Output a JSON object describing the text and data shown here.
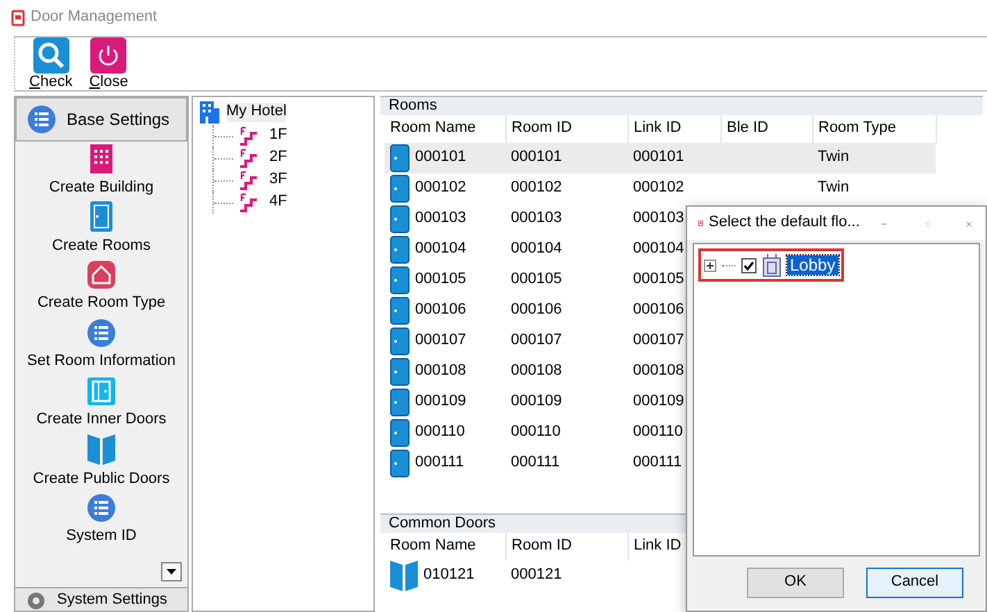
{
  "window": {
    "title": "Door Management"
  },
  "toolbar": [
    {
      "label": "Check",
      "kind": "search"
    },
    {
      "label": "Close",
      "kind": "power"
    }
  ],
  "nav": {
    "header": "Base Settings",
    "items": [
      {
        "label": "Create Building",
        "kind": "building"
      },
      {
        "label": "Create Rooms",
        "kind": "door"
      },
      {
        "label": "Create Room Type",
        "kind": "house"
      },
      {
        "label": "Set Room Information",
        "kind": "list"
      },
      {
        "label": "Create Inner Doors",
        "kind": "inner"
      },
      {
        "label": "Create Public Doors",
        "kind": "double"
      },
      {
        "label": "System ID",
        "kind": "list"
      }
    ],
    "footer": "System Settings"
  },
  "tree": {
    "root": "My Hotel",
    "children": [
      {
        "label": "1F"
      },
      {
        "label": "2F"
      },
      {
        "label": "3F"
      },
      {
        "label": "4F"
      }
    ]
  },
  "rooms": {
    "title": "Rooms",
    "columns": [
      "Room Name",
      "Room ID",
      "Link ID",
      "Ble ID",
      "Room Type"
    ],
    "rows": [
      {
        "name": "000101",
        "room_id": "000101",
        "link_id": "000101",
        "room_type": "Twin",
        "selected": true
      },
      {
        "name": "000102",
        "room_id": "000102",
        "link_id": "000102",
        "room_type": "Twin",
        "selected": false
      },
      {
        "name": "000103",
        "room_id": "000103",
        "link_id": "000103",
        "selected": false
      },
      {
        "name": "000104",
        "room_id": "000104",
        "link_id": "000104",
        "selected": false
      },
      {
        "name": "000105",
        "room_id": "000105",
        "link_id": "000105",
        "selected": false
      },
      {
        "name": "000106",
        "room_id": "000106",
        "link_id": "000106",
        "selected": false
      },
      {
        "name": "000107",
        "room_id": "000107",
        "link_id": "000107",
        "selected": false
      },
      {
        "name": "000108",
        "room_id": "000108",
        "link_id": "000108",
        "selected": false
      },
      {
        "name": "000109",
        "room_id": "000109",
        "link_id": "000109",
        "selected": false
      },
      {
        "name": "000110",
        "room_id": "000110",
        "link_id": "000110",
        "selected": false
      },
      {
        "name": "000111",
        "room_id": "000111",
        "link_id": "000111",
        "selected": false
      }
    ]
  },
  "common_doors": {
    "title": "Common Doors",
    "columns": [
      "Room Name",
      "Room ID",
      "Link ID"
    ],
    "rows": [
      {
        "name": "010121",
        "room_id": "000121"
      }
    ]
  },
  "dialog": {
    "title": "Select the default flo...",
    "items": [
      {
        "label": "Lobby",
        "expanded": false,
        "checked": true,
        "selected": true
      }
    ],
    "buttons": [
      {
        "label": "OK",
        "focused": false
      },
      {
        "label": "Cancel",
        "focused": true
      }
    ]
  }
}
